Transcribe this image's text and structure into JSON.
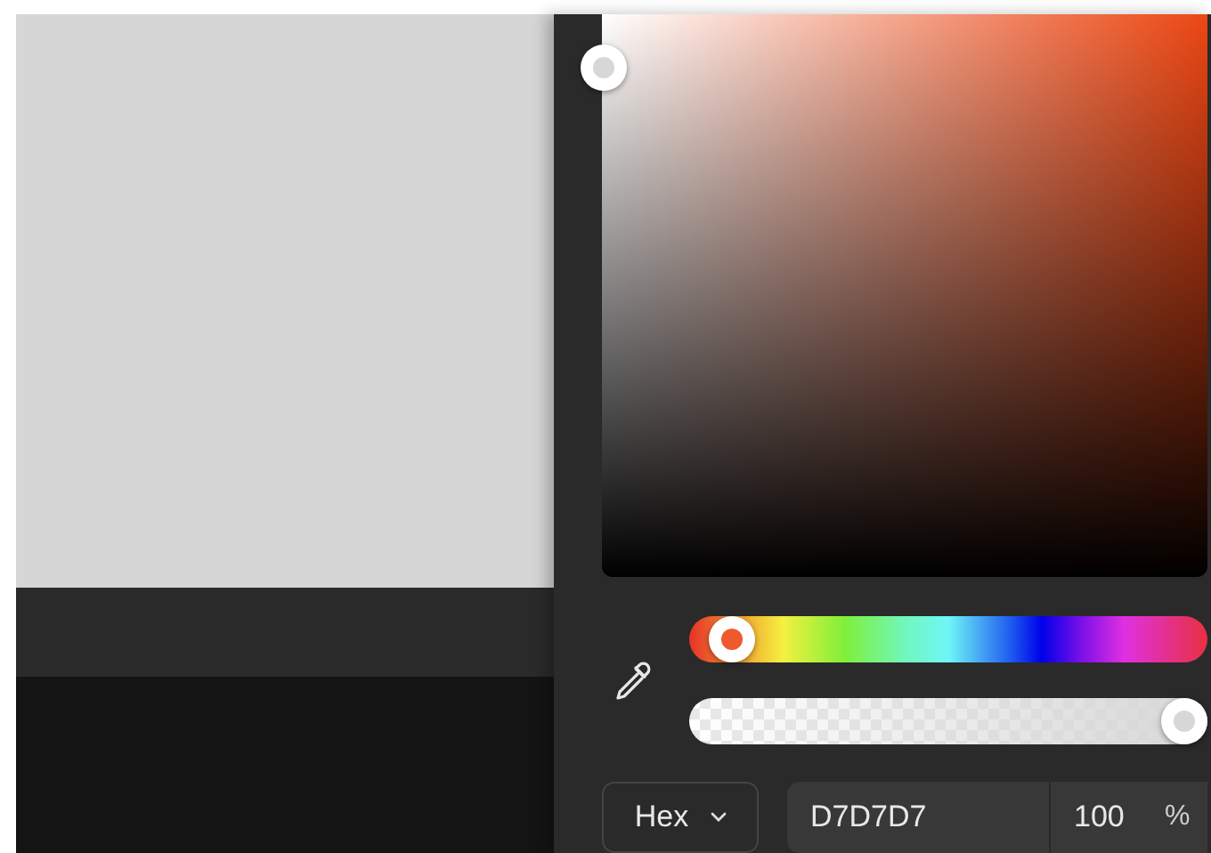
{
  "format_select": {
    "value": "Hex"
  },
  "hex_field": {
    "value": "D7D7D7"
  },
  "opacity_field": {
    "value": "100",
    "unit": "%"
  }
}
